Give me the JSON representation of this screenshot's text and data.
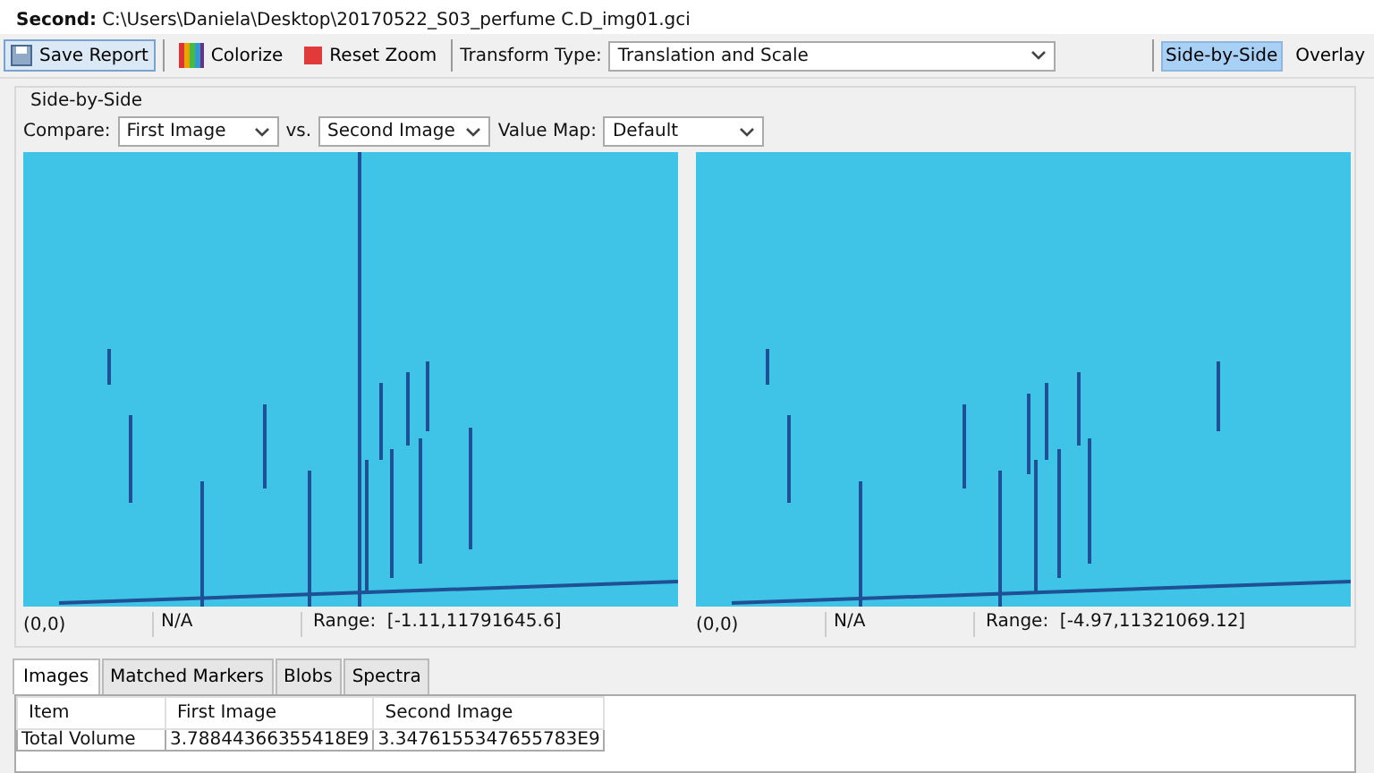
{
  "header": {
    "label": "Second:",
    "path": "C:\\Users\\Daniela\\Desktop\\20170522_S03_perfume C.D_img01.gci"
  },
  "toolbar": {
    "buttons": [
      {
        "label": "Save Report",
        "kind": "save",
        "selected": true
      },
      {
        "label": "Colorize",
        "kind": "colorize",
        "selected": false
      },
      {
        "label": "Reset Zoom",
        "kind": "reset",
        "selected": false
      }
    ],
    "transform_label": "Transform Type:",
    "transform_value": "Translation and Scale"
  },
  "view_modes": [
    {
      "label": "Side-by-Side",
      "selected": true
    },
    {
      "label": "Overlay",
      "selected": false
    }
  ],
  "group_title": "Side-by-Side",
  "compare": {
    "label": "Compare:",
    "first": "First Image",
    "vs": "vs.",
    "second": "Second Image",
    "value_map_label": "Value Map:",
    "value_map": "Default"
  },
  "panels": [
    {
      "coords": "(0,0)",
      "value": "N/A",
      "range": "Range:  [-1.11,11791645.6]"
    },
    {
      "coords": "(0,0)",
      "value": "N/A",
      "range": "Range:  [-4.97,11321069.12]"
    }
  ],
  "tabs": [
    {
      "label": "Images",
      "selected": true
    },
    {
      "label": "Matched Markers",
      "selected": false
    },
    {
      "label": "Blobs",
      "selected": false
    },
    {
      "label": "Spectra",
      "selected": false
    }
  ],
  "table": {
    "columns": [
      "Item",
      "First Image",
      "Second Image"
    ],
    "rows": [
      [
        "Total Volume",
        "3.78844366355418E9",
        "3.3476155347655783E9"
      ]
    ]
  }
}
